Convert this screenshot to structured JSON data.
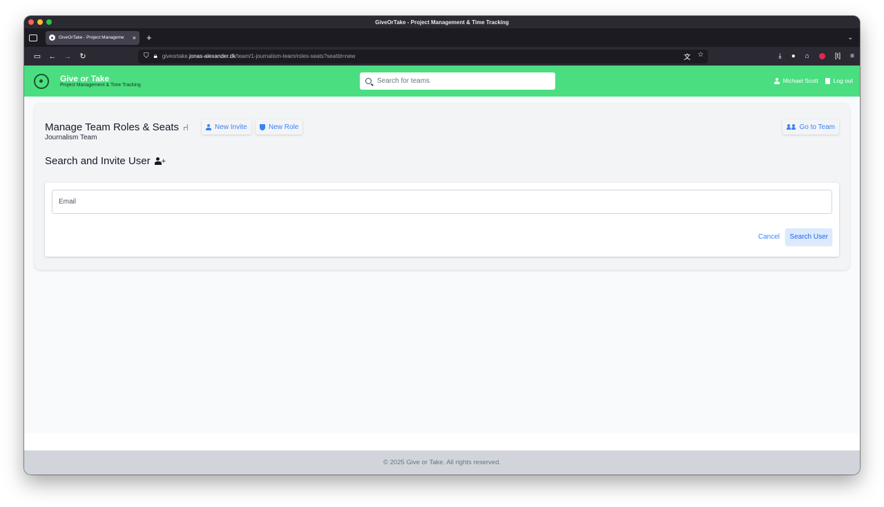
{
  "browser": {
    "window_title": "GiveOrTake - Project Management & Time Tracking",
    "tab": {
      "title": "GiveOrTake - Project Manageme",
      "close": "×"
    },
    "new_tab": "+",
    "url": {
      "prefix": "giveortake.",
      "domain": "jonas-alexander.dk",
      "path": "/team/1-journalism-team/roles-seats?seatId=new"
    }
  },
  "header": {
    "brand_name": "Give or Take",
    "brand_tagline": "Project Management & Time Tracking",
    "search_placeholder": "Search for teams",
    "user_name": "Michael Scott",
    "logout_label": "Log out"
  },
  "main": {
    "title": "Manage Team Roles & Seats",
    "team_name": "Journalism Team",
    "new_invite_label": "New Invite",
    "new_role_label": "New Role",
    "go_to_team_label": "Go to Team",
    "invite_heading": "Search and Invite User",
    "email_placeholder": "Email",
    "cancel_label": "Cancel",
    "search_user_label": "Search User"
  },
  "footer": {
    "text": "© 2025 Give or Take. All rights reserved."
  },
  "colors": {
    "header_green": "#4ade80",
    "accent_blue": "#3b82f6",
    "footer_gray": "#d1d5db"
  }
}
